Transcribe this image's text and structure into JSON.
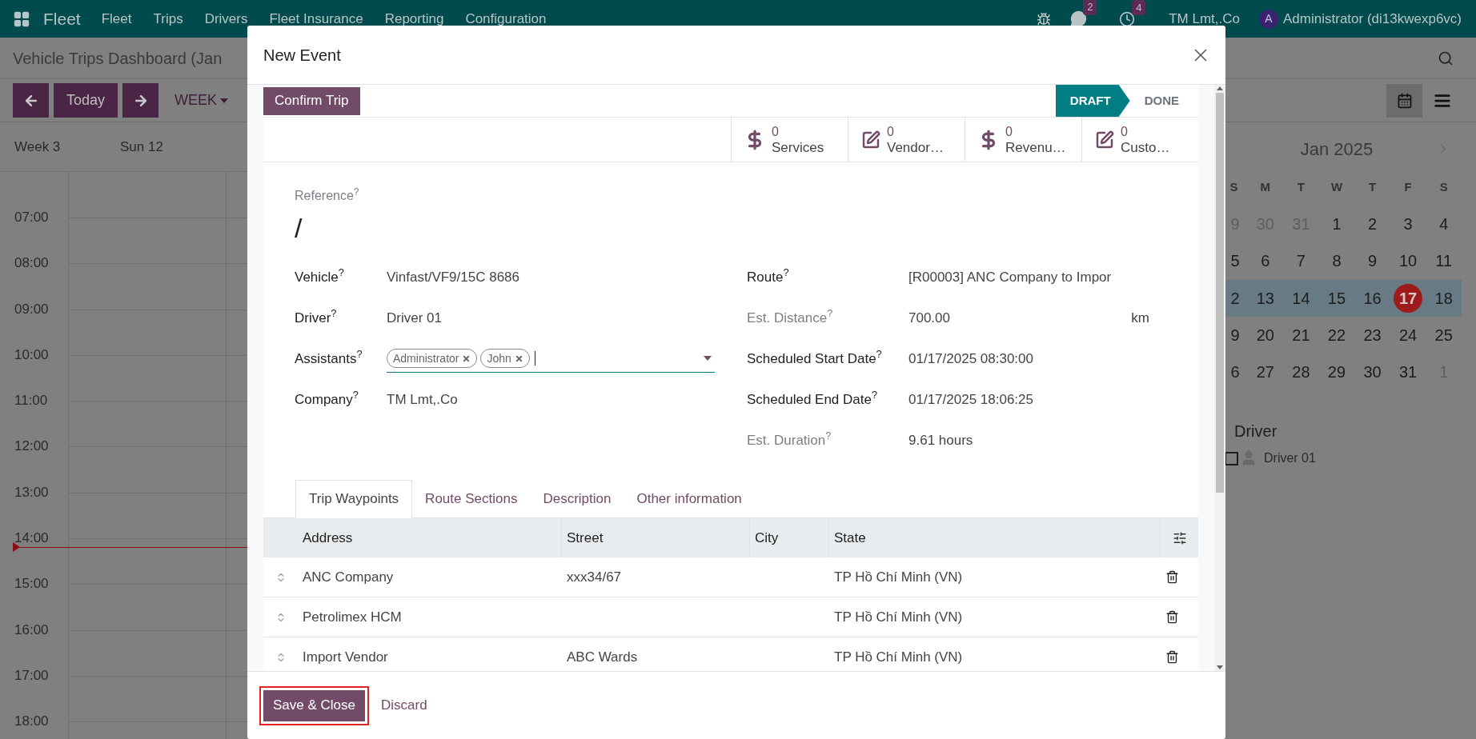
{
  "navbar": {
    "app_name": "Fleet",
    "menu": [
      "Fleet",
      "Trips",
      "Drivers",
      "Fleet Insurance",
      "Reporting",
      "Configuration"
    ],
    "messages_count": "2",
    "activities_count": "4",
    "company": "TM Lmt,.Co",
    "user_initial": "A",
    "user": "Administrator (di13kwexp6vc)"
  },
  "calendar": {
    "title": "Vehicle Trips Dashboard (Jan",
    "today_button": "Today",
    "scale": "WEEK",
    "week_label": "Week 3",
    "day_header": "Sun 12",
    "hours": [
      "07:00",
      "08:00",
      "09:00",
      "10:00",
      "11:00",
      "12:00",
      "13:00",
      "14:00",
      "15:00",
      "16:00",
      "17:00",
      "18:00"
    ],
    "view_modes": [
      {
        "kind": "calendar",
        "selected": true
      },
      {
        "kind": "list",
        "selected": false
      }
    ]
  },
  "mini_calendar": {
    "month": "Jan 2025",
    "weekdays": [
      "S",
      "M",
      "T",
      "W",
      "T",
      "F",
      "S"
    ],
    "weeks": [
      {
        "selected": false,
        "days": [
          {
            "label": "9",
            "muted": true,
            "today": false
          },
          {
            "label": "30",
            "muted": true,
            "today": false
          },
          {
            "label": "31",
            "muted": true,
            "today": false
          },
          {
            "label": "1",
            "muted": false,
            "today": false
          },
          {
            "label": "2",
            "muted": false,
            "today": false
          },
          {
            "label": "3",
            "muted": false,
            "today": false
          },
          {
            "label": "4",
            "muted": false,
            "today": false
          }
        ]
      },
      {
        "selected": false,
        "days": [
          {
            "label": "5",
            "muted": false,
            "today": false
          },
          {
            "label": "6",
            "muted": false,
            "today": false
          },
          {
            "label": "7",
            "muted": false,
            "today": false
          },
          {
            "label": "8",
            "muted": false,
            "today": false
          },
          {
            "label": "9",
            "muted": false,
            "today": false
          },
          {
            "label": "10",
            "muted": false,
            "today": false
          },
          {
            "label": "11",
            "muted": false,
            "today": false
          }
        ]
      },
      {
        "selected": true,
        "days": [
          {
            "label": "2",
            "muted": false,
            "today": false
          },
          {
            "label": "13",
            "muted": false,
            "today": false
          },
          {
            "label": "14",
            "muted": false,
            "today": false
          },
          {
            "label": "15",
            "muted": false,
            "today": false
          },
          {
            "label": "16",
            "muted": false,
            "today": false
          },
          {
            "label": "17",
            "muted": false,
            "today": true
          },
          {
            "label": "18",
            "muted": false,
            "today": false
          }
        ]
      },
      {
        "selected": false,
        "days": [
          {
            "label": "9",
            "muted": false,
            "today": false
          },
          {
            "label": "20",
            "muted": false,
            "today": false
          },
          {
            "label": "21",
            "muted": false,
            "today": false
          },
          {
            "label": "22",
            "muted": false,
            "today": false
          },
          {
            "label": "23",
            "muted": false,
            "today": false
          },
          {
            "label": "24",
            "muted": false,
            "today": false
          },
          {
            "label": "25",
            "muted": false,
            "today": false
          }
        ]
      },
      {
        "selected": false,
        "days": [
          {
            "label": "6",
            "muted": false,
            "today": false
          },
          {
            "label": "27",
            "muted": false,
            "today": false
          },
          {
            "label": "28",
            "muted": false,
            "today": false
          },
          {
            "label": "29",
            "muted": false,
            "today": false
          },
          {
            "label": "30",
            "muted": false,
            "today": false
          },
          {
            "label": "31",
            "muted": false,
            "today": false
          },
          {
            "label": "1",
            "muted": true,
            "today": false
          }
        ]
      }
    ]
  },
  "filters": {
    "title": "Driver",
    "items": [
      {
        "label": "Driver 01",
        "checked": false
      }
    ]
  },
  "dialog": {
    "title": "New Event",
    "confirm_button": "Confirm Trip",
    "stages": [
      {
        "label": "DRAFT",
        "selected": true
      },
      {
        "label": "DONE",
        "selected": false
      }
    ],
    "stat_buttons": [
      {
        "kind": "money",
        "count": "0",
        "label": "Services"
      },
      {
        "kind": "edit",
        "count": "0",
        "label": "Vendor…"
      },
      {
        "kind": "money",
        "count": "0",
        "label": "Revenu…"
      },
      {
        "kind": "edit",
        "count": "0",
        "label": "Custo…"
      }
    ],
    "reference": {
      "label": "Reference$^{?}$",
      "value": "/"
    },
    "left_fields": [
      {
        "kind": "text",
        "label": "Vehicle$^{?}$",
        "value": "Vinfast/VF9/15C 8686",
        "readonly": false
      },
      {
        "kind": "text",
        "label": "Driver$^{?}$",
        "value": "Driver 01",
        "readonly": false
      },
      {
        "kind": "tags",
        "label": "Assistants$^{?}$",
        "tags": [
          "Administrator",
          "John"
        ],
        "readonly": false
      },
      {
        "kind": "text",
        "label": "Company$^{?}$",
        "value": "TM Lmt,.Co",
        "readonly": false
      }
    ],
    "right_fields": [
      {
        "kind": "text",
        "label": "Route$^{?}$",
        "value": "[R00003] ANC Company to Impor",
        "readonly": false
      },
      {
        "kind": "text",
        "label": "Est. Distance$^{?}$",
        "value": "700.00",
        "unit": "km",
        "readonly": true
      },
      {
        "kind": "text",
        "label": "Scheduled Start Date$^{?}$",
        "value": "01/17/2025 08:30:00",
        "readonly": false
      },
      {
        "kind": "text",
        "label": "Scheduled End Date$^{?}$",
        "value": "01/17/2025 18:06:25",
        "readonly": false
      },
      {
        "kind": "text",
        "label": "Est. Duration$^{?}$",
        "value": "9.61 hours",
        "readonly": true
      }
    ],
    "tabs": [
      {
        "label": "Trip Waypoints",
        "selected": true
      },
      {
        "label": "Route Sections",
        "selected": false
      },
      {
        "label": "Description",
        "selected": false
      },
      {
        "label": "Other information",
        "selected": false
      }
    ],
    "table": {
      "columns": [
        "Address",
        "Street",
        "City",
        "State"
      ],
      "rows": [
        [
          "ANC Company",
          "xxx34/67",
          null,
          "TP Hồ Chí Minh (VN)"
        ],
        [
          "Petrolimex HCM",
          null,
          null,
          "TP Hồ Chí Minh (VN)"
        ],
        [
          "Import Vendor",
          "ABC Wards",
          null,
          "TP Hồ Chí Minh (VN)"
        ]
      ]
    },
    "footer": {
      "save_button": "Save & Close",
      "save_highlighted": true,
      "discard_button": "Discard"
    }
  }
}
